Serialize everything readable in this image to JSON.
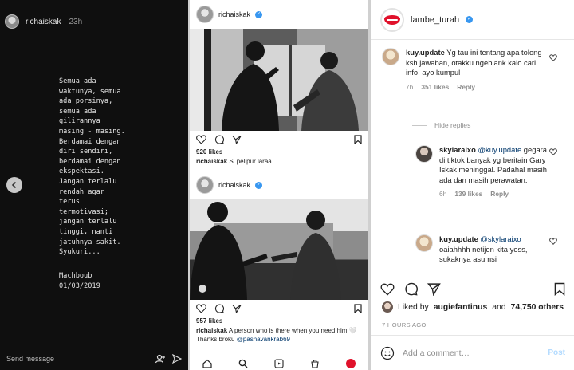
{
  "story": {
    "username": "richaiskak",
    "time": "23h",
    "text": "Semua ada\nwaktunya, semua\nada porsinya,\nsemua ada\ngilirannya\nmasing - masing.\nBerdamai dengan\ndiri sendiri,\nberdamai dengan\nekspektasi.\nJangan terlalu\nrendah agar\nterus\ntermotivasi;\njangan terlalu\ntinggi, nanti\njatuhnya sakit.\nSyukuri...",
    "signature": "Machboub\n01/03/2019",
    "send_message_placeholder": "Send message"
  },
  "feed": {
    "post1": {
      "username": "richaiskak",
      "likes": "920 likes",
      "caption_user": "richaiskak",
      "caption_text": "Si pelipur laraa.."
    },
    "post2": {
      "username": "richaiskak",
      "likes": "957 likes",
      "caption_user": "richaiskak",
      "caption_text": "A person who is there when you need him 🤍",
      "caption_line2": "Thanks broku",
      "caption_mention": "@pashavankrab69"
    }
  },
  "comments_panel": {
    "account": "lambe_turah",
    "comments": [
      {
        "user": "kuy.update",
        "text": "Yg tau ini tentang apa tolong ksh jawaban, otakku ngeblank kalo cari info, ayo kumpul",
        "time": "7h",
        "likes": "351 likes",
        "reply": "Reply"
      }
    ],
    "hide_replies": "Hide replies",
    "replies": [
      {
        "user": "skylaraixo",
        "mention": "@kuy.update",
        "text": "gegara di tiktok banyak yg beritain Gary Iskak meninggal. Padahal masih ada dan masih perawatan.",
        "time": "6h",
        "likes": "139 likes",
        "reply": "Reply"
      },
      {
        "user": "kuy.update",
        "mention": "@skylaraixo",
        "text": "oaiahhhh netijen kita yess, sukaknya asumsi"
      }
    ],
    "liked_by_prefix": "Liked by",
    "liked_by_user": "augiefantinus",
    "liked_by_and": "and",
    "liked_by_count": "74,750 others",
    "posted_time": "7 HOURS AGO",
    "add_comment_placeholder": "Add a comment…",
    "post_label": "Post"
  },
  "colors": {
    "verified": "#3897f0",
    "brand_lips": "#e0112b",
    "mention": "#00376b"
  }
}
